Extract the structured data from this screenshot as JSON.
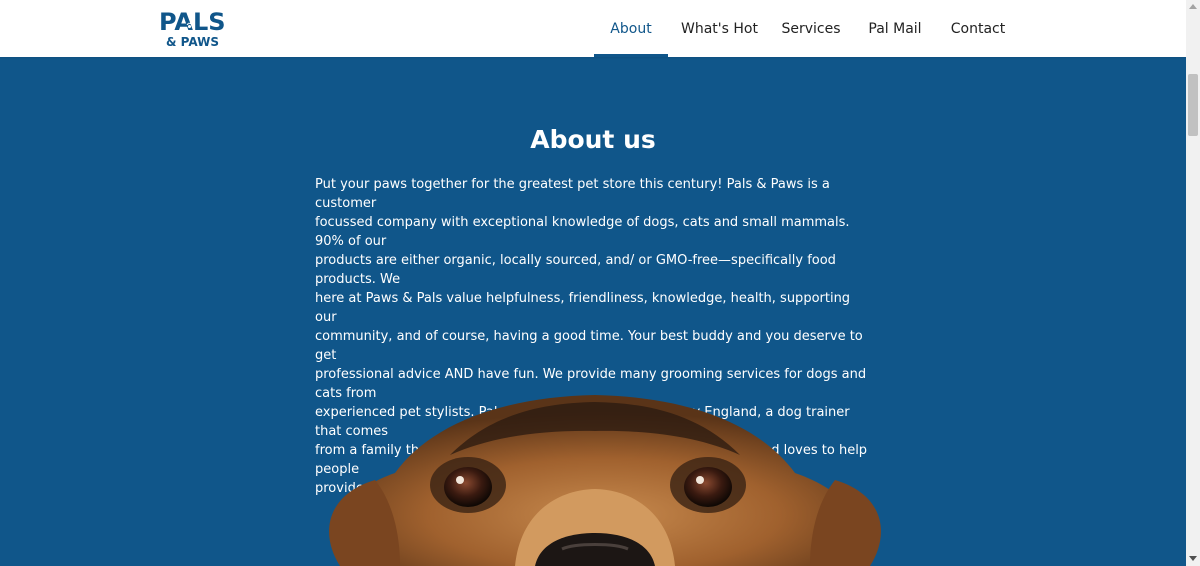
{
  "brand": {
    "logo_top": "PALS",
    "logo_bottom": "& PAWS",
    "color": "#10568a"
  },
  "nav": {
    "items": [
      {
        "label": "About",
        "active": true
      },
      {
        "label": "What's Hot",
        "active": false
      },
      {
        "label": "Services",
        "active": false
      },
      {
        "label": "Pal Mail",
        "active": false
      },
      {
        "label": "Contact",
        "active": false
      }
    ]
  },
  "about": {
    "title": "About us",
    "body": "Put your paws together for the greatest pet store this century! Pals & Paws is a customer\nfocussed company with exceptional knowledge of dogs, cats and small mammals. 90% of our\nproducts are either organic, locally sourced, and/ or GMO-free—specifically food products. We\nhere at Paws & Pals value helpfulness, friendliness, knowledge, health, supporting our\ncommunity, and of course, having a good time. Your best buddy and you deserve to get\nprofessional advice AND have fun. We provide many grooming services for dogs and cats from\nexperienced pet stylists. Pals Paws was started up by Tracy England, a dog trainer that comes\nfrom a family that bred labradoodles. She is a huge dog enthusiast and loves to help people\nprovide the best for their pets."
  },
  "colors": {
    "background": "#10568a",
    "text": "#ffffff",
    "nav_text": "#222222"
  }
}
